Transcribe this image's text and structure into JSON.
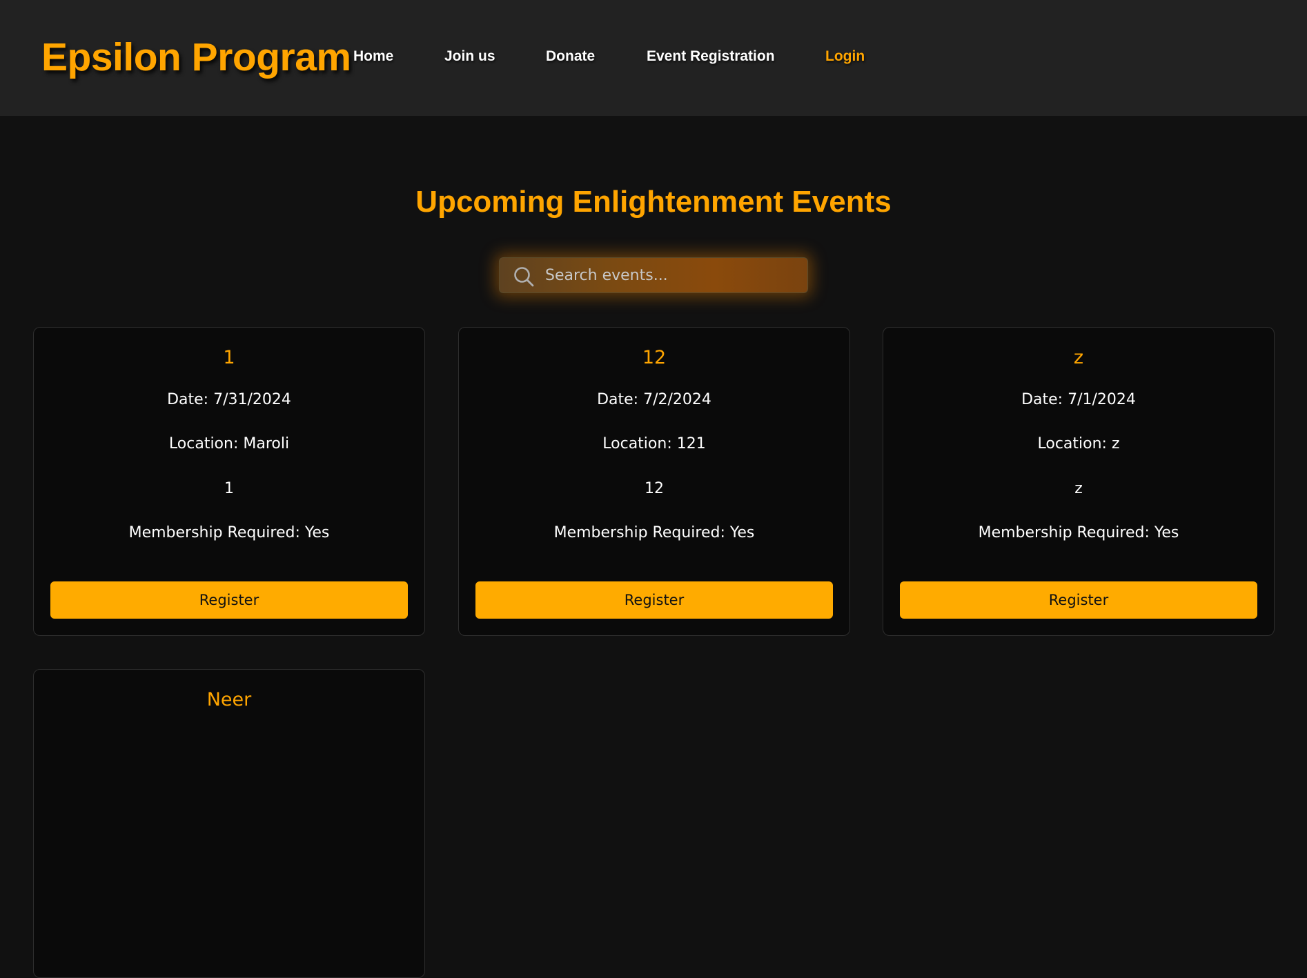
{
  "header": {
    "logo": "Epsilon Program",
    "nav": [
      {
        "label": "Home",
        "active": false
      },
      {
        "label": "Join us",
        "active": false
      },
      {
        "label": "Donate",
        "active": false
      },
      {
        "label": "Event Registration",
        "active": false
      },
      {
        "label": "Login",
        "active": true
      }
    ]
  },
  "main": {
    "title": "Upcoming Enlightenment Events",
    "search": {
      "placeholder": "Search events...",
      "value": ""
    },
    "events": [
      {
        "title": "1",
        "date": "Date: 7/31/2024",
        "location": "Location: Maroli",
        "description": "1",
        "membership": "Membership Required: Yes",
        "button": "Register"
      },
      {
        "title": "12",
        "date": "Date: 7/2/2024",
        "location": "Location: 121",
        "description": "12",
        "membership": "Membership Required: Yes",
        "button": "Register"
      },
      {
        "title": "z",
        "date": "Date: 7/1/2024",
        "location": "Location: z",
        "description": "z",
        "membership": "Membership Required: Yes",
        "button": "Register"
      },
      {
        "title": "Neer"
      }
    ]
  },
  "colors": {
    "accent": "#ffa500",
    "button": "#ffab00",
    "header_bg": "#222222",
    "page_bg": "#111111",
    "card_bg": "#0a0a0a"
  },
  "icons": {
    "search": "search-icon"
  }
}
